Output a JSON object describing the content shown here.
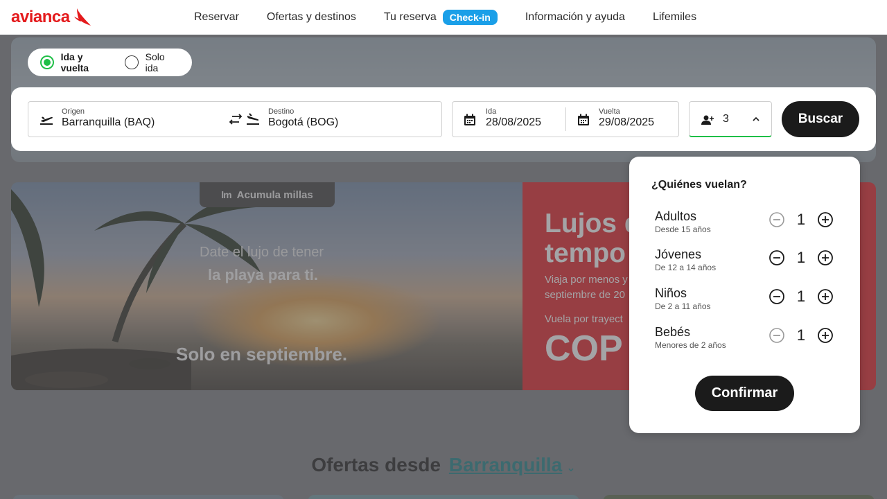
{
  "header": {
    "logo": "avianca",
    "nav": [
      {
        "label": "Reservar"
      },
      {
        "label": "Ofertas y destinos"
      },
      {
        "label": "Tu reserva",
        "badge": "Check-in"
      },
      {
        "label": "Información y ayuda"
      },
      {
        "label": "Lifemiles"
      }
    ]
  },
  "trip_type": {
    "options": [
      "Ida y vuelta",
      "Solo ida"
    ],
    "selected": "Ida y vuelta"
  },
  "search": {
    "origin_label": "Origen",
    "origin_value": "Barranquilla  (BAQ)",
    "destination_label": "Destino",
    "destination_value": "Bogotá  (BOG)",
    "depart_label": "Ida",
    "depart_value": "28/08/2025",
    "return_label": "Vuelta",
    "return_value": "29/08/2025",
    "passengers_count": "3",
    "search_button": "Buscar"
  },
  "banner": {
    "tag": "Acumula millas",
    "tag_icon": "lm",
    "line1": "Date el lujo de tener",
    "line2": "la playa para ti.",
    "line3": "Solo en septiembre.",
    "red_title_1": "Lujos de",
    "red_title_2": "tempo",
    "red_sub_1": "Viaja por menos y",
    "red_sub_2": "septiembre de 20",
    "red_from": "Vuela por trayect",
    "red_price": "COP"
  },
  "offers": {
    "prefix": "Ofertas desde",
    "city": "Barranquilla"
  },
  "passengers_popover": {
    "title": "¿Quiénes vuelan?",
    "rows": [
      {
        "name": "Adultos",
        "desc": "Desde 15 años",
        "value": "1",
        "minus_enabled": false
      },
      {
        "name": "Jóvenes",
        "desc": "De 12 a 14 años",
        "value": "1",
        "minus_enabled": true
      },
      {
        "name": "Niños",
        "desc": "De 2 a 11 años",
        "value": "1",
        "minus_enabled": true
      },
      {
        "name": "Bebés",
        "desc": "Menores de 2 años",
        "value": "1",
        "minus_enabled": false
      }
    ],
    "confirm_button": "Confirmar"
  },
  "colors": {
    "brand_red": "#e41a1c",
    "accent_green": "#1fbf47",
    "badge_blue": "#1a9fe8",
    "link_teal": "#1a7f86"
  }
}
